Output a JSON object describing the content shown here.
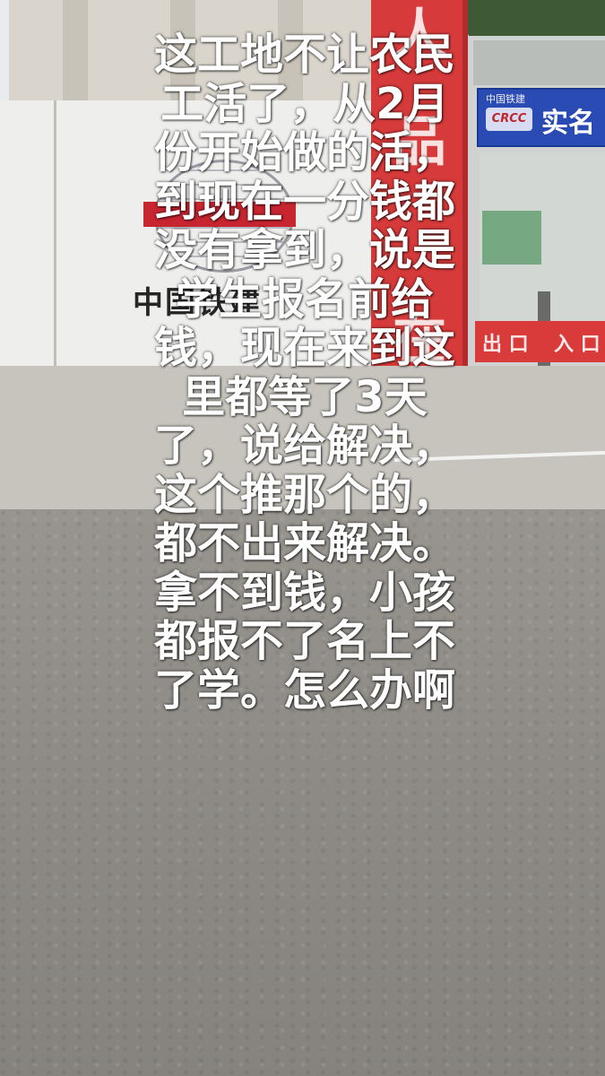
{
  "scene": {
    "sign_red_chars": [
      "人",
      "品",
      "在"
    ],
    "wall_logo_text": "中国铁建",
    "blue_board_small": "中国铁建",
    "blue_board_badge": "CRCC",
    "blue_board_text": "实名",
    "gate_strip_exit": "出 口",
    "gate_strip_entry": "入 口"
  },
  "caption": {
    "lines": [
      "这工地不让农民",
      "工活了，从2月",
      "份开始做的活，",
      "到现在一分钱都",
      "没有拿到，说是",
      "学生报名前给",
      "钱，现在来到这",
      "里都等了3天",
      "了，说给解决，",
      "这个推那个的，",
      "都不出来解决。",
      "拿不到钱，小孩",
      "都报不了名上不",
      "了学。怎么办啊"
    ]
  }
}
